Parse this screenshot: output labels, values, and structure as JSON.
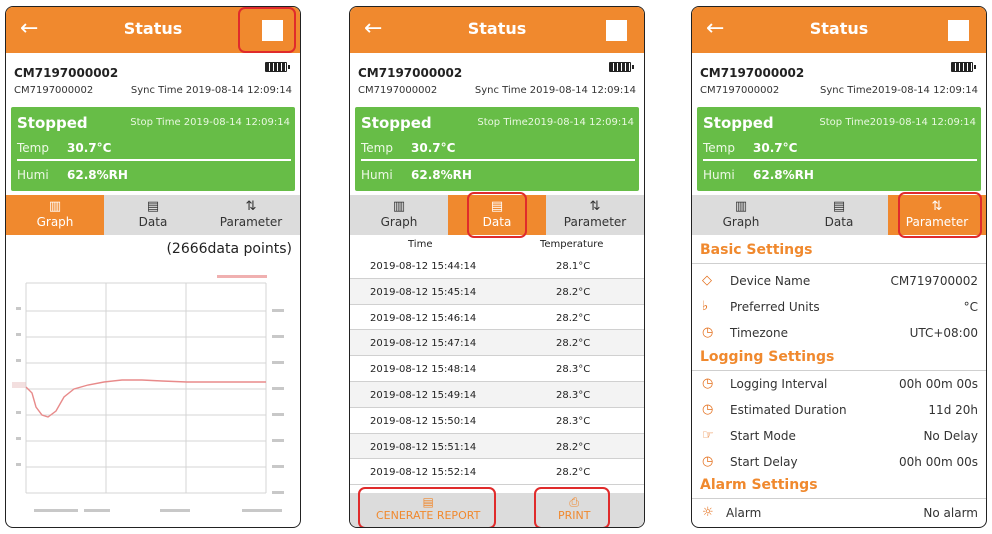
{
  "header": {
    "title": "Status",
    "back_icon": "arrow-left-icon"
  },
  "device": {
    "id": "CM7197000002",
    "sub_id": "CM7197000002",
    "sync_p1": "Sync  Time 2019-08-14 12:09:14",
    "sync_p2": "Sync Time 2019-08-14 12:09:14",
    "sync_p3": "Sync Time2019-08-14 12:09:14"
  },
  "status": {
    "state": "Stopped",
    "stop_p1": "Stop  Time 2019-08-14 12:09:14",
    "stop_p2": "Stop Time2019-08-14 12:09:14",
    "stop_p3": "Stop Time2019-08-14 12:09:14",
    "temp_label": "Temp",
    "temp_value": "30.7°C",
    "humi_label": "Humi",
    "humi_value": "62.8%RH"
  },
  "tabs": {
    "graph": "Graph",
    "data": "Data",
    "parameter": "Parameter"
  },
  "graph": {
    "count_label": "(2666data points)"
  },
  "data_table": {
    "col_time": "Time",
    "col_temp": "Temperature",
    "rows": [
      {
        "time": "2019-08-12 15:44:14",
        "temp": "28.1°C"
      },
      {
        "time": "2019-08-12 15:45:14",
        "temp": "28.2°C"
      },
      {
        "time": "2019-08-12 15:46:14",
        "temp": "28.2°C"
      },
      {
        "time": "2019-08-12 15:47:14",
        "temp": "28.2°C"
      },
      {
        "time": "2019-08-12 15:48:14",
        "temp": "28.3°C"
      },
      {
        "time": "2019-08-12 15:49:14",
        "temp": "28.3°C"
      },
      {
        "time": "2019-08-12 15:50:14",
        "temp": "28.3°C"
      },
      {
        "time": "2019-08-12 15:51:14",
        "temp": "28.2°C"
      },
      {
        "time": "2019-08-12 15:52:14",
        "temp": "28.2°C"
      }
    ]
  },
  "actions": {
    "report": "CENERATE REPORT",
    "print": "PRINT"
  },
  "params": {
    "basic_title": "Basic Settings",
    "device_name_label": "Device Name",
    "device_name_value": "CM719700002",
    "units_label": "Preferred Units",
    "units_value": "°C",
    "timezone_label": "Timezone",
    "timezone_value": "UTC+08:00",
    "logging_title": "Logging Settings",
    "interval_label": "Logging  Interval",
    "interval_value": "00h 00m 00s",
    "duration_label": "Estimated Duration",
    "duration_value": "11d 20h",
    "start_mode_label": "Start Mode",
    "start_mode_value": "No Delay",
    "start_delay_label": "Start Delay",
    "start_delay_value": "00h 00m 00s",
    "alarm_title": "Alarm Settings",
    "alarm_label": "Alarm",
    "alarm_value": "No alarm"
  },
  "colors": {
    "accent": "#f0892e",
    "status_green": "#67bd47",
    "highlight": "#e02b2b"
  }
}
